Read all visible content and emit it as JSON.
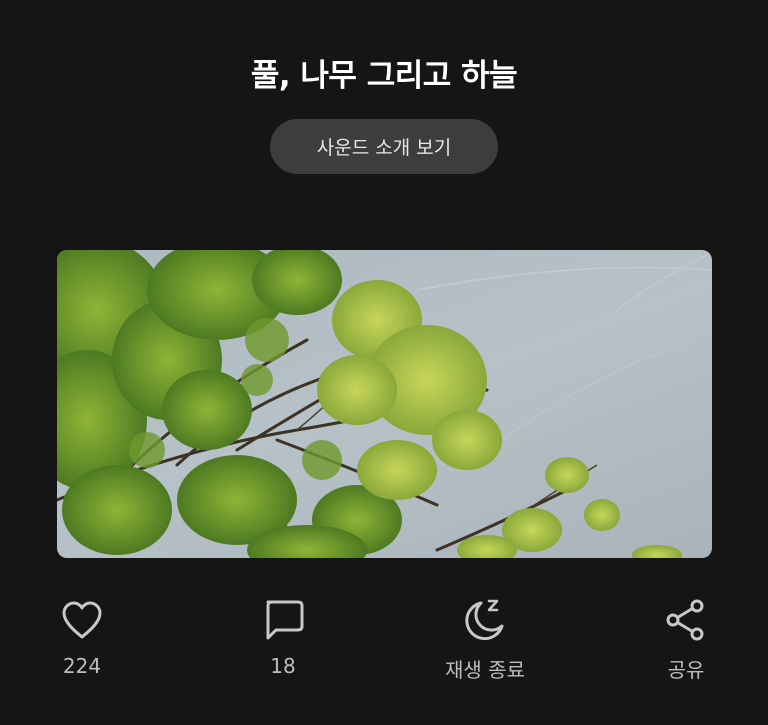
{
  "header": {
    "title": "풀, 나무 그리고 하늘",
    "intro_button_label": "사운드 소개 보기"
  },
  "image": {
    "subject": "tree-canopy-against-sky"
  },
  "actions": [
    {
      "icon": "heart-icon",
      "label": "224"
    },
    {
      "icon": "comment-icon",
      "label": "18"
    },
    {
      "icon": "sleep-timer-icon",
      "label": "재생 종료"
    },
    {
      "icon": "share-icon",
      "label": "공유"
    }
  ],
  "colors": {
    "background": "#151515",
    "button_bg": "#3d3d3d",
    "icon": "#c8c8c8",
    "label": "#bdbdbd"
  }
}
